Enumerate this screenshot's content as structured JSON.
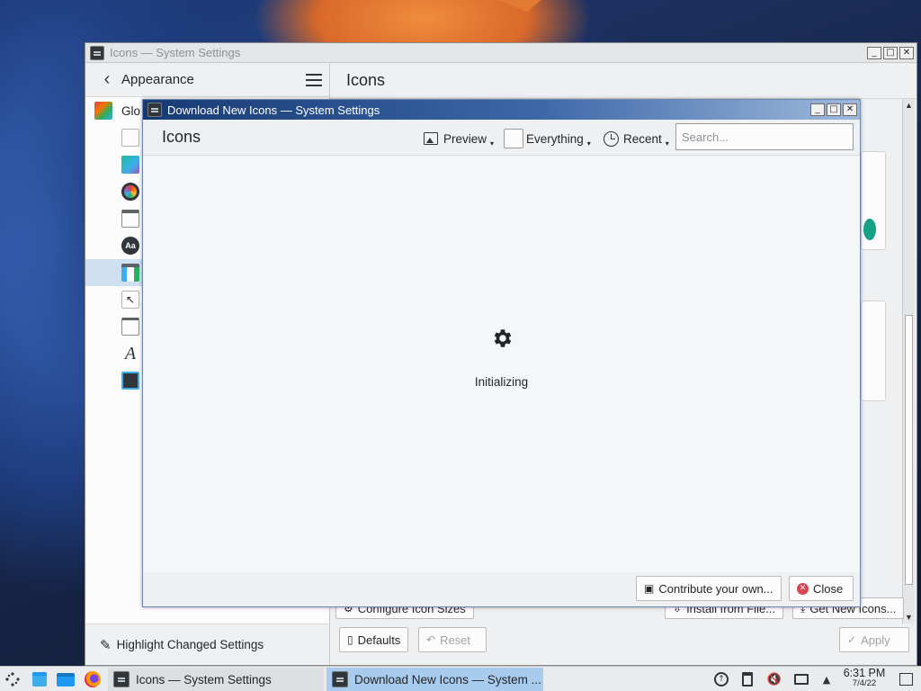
{
  "main_window": {
    "title": "Icons — System Settings",
    "sidebar": {
      "section": "Appearance",
      "first_item_label": "Glo",
      "footer_label": "Highlight Changed Settings"
    },
    "page_title": "Icons",
    "buttons": {
      "configure_sizes": "Configure Icon Sizes",
      "install_from_file": "Install from File...",
      "get_new_icons": "Get New Icons...",
      "defaults": "Defaults",
      "reset": "Reset",
      "apply": "Apply"
    }
  },
  "dialog": {
    "title": "Download New Icons — System Settings",
    "heading": "Icons",
    "toolbar": {
      "preview": "Preview",
      "everything": "Everything",
      "recent": "Recent",
      "search_placeholder": "Search..."
    },
    "status": "Initializing",
    "footer": {
      "contribute": "Contribute your own...",
      "close": "Close"
    }
  },
  "taskbar": {
    "tasks": [
      {
        "label": "Icons  — System Settings",
        "active": false
      },
      {
        "label": "Download New Icons — System ...",
        "active": true
      }
    ],
    "clock": {
      "time": "6:31 PM",
      "date": "7/4/22"
    }
  },
  "colors": {
    "accent": "#a9cbee",
    "selected_row": "#cfe0f0",
    "dialog_title_start": "#173a73",
    "close_red": "#da4453"
  }
}
